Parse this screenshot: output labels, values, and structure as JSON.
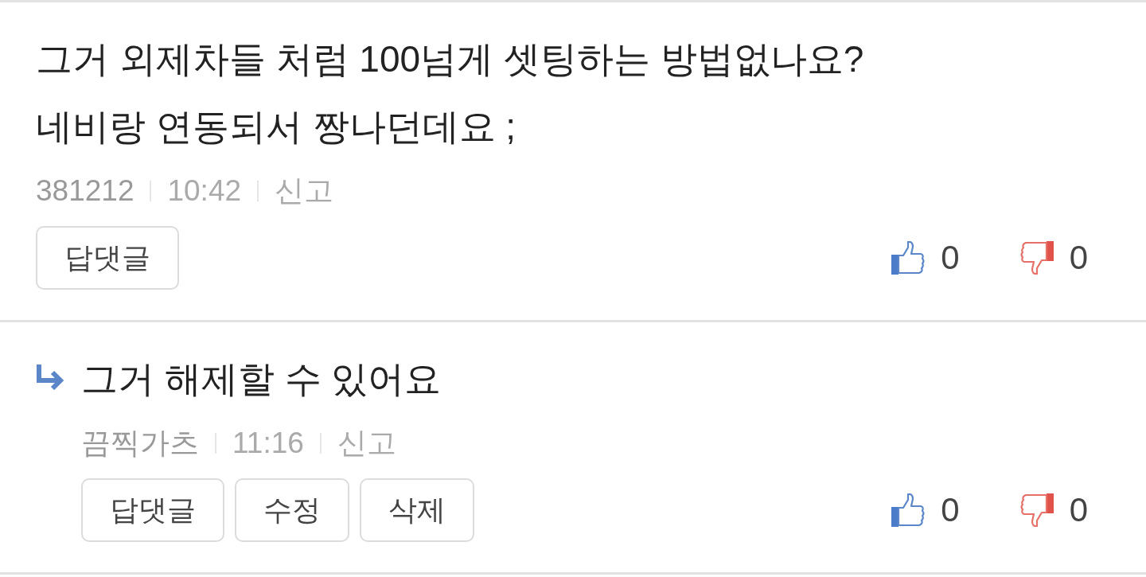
{
  "comments": [
    {
      "kind": "comment",
      "text": "그거 외제차들 처럼 100넘게 셋팅하는 방법없나요?\n네비랑 연동되서 짱나던데요 ;",
      "author": "381212",
      "time": "10:42",
      "report": "신고",
      "actions": [
        "답댓글"
      ],
      "likes": "0",
      "dislikes": "0"
    },
    {
      "kind": "reply",
      "text": "그거 해제할 수 있어요",
      "author": "끔찍가츠",
      "time": "11:16",
      "report": "신고",
      "actions": [
        "답댓글",
        "수정",
        "삭제"
      ],
      "likes": "0",
      "dislikes": "0"
    }
  ]
}
